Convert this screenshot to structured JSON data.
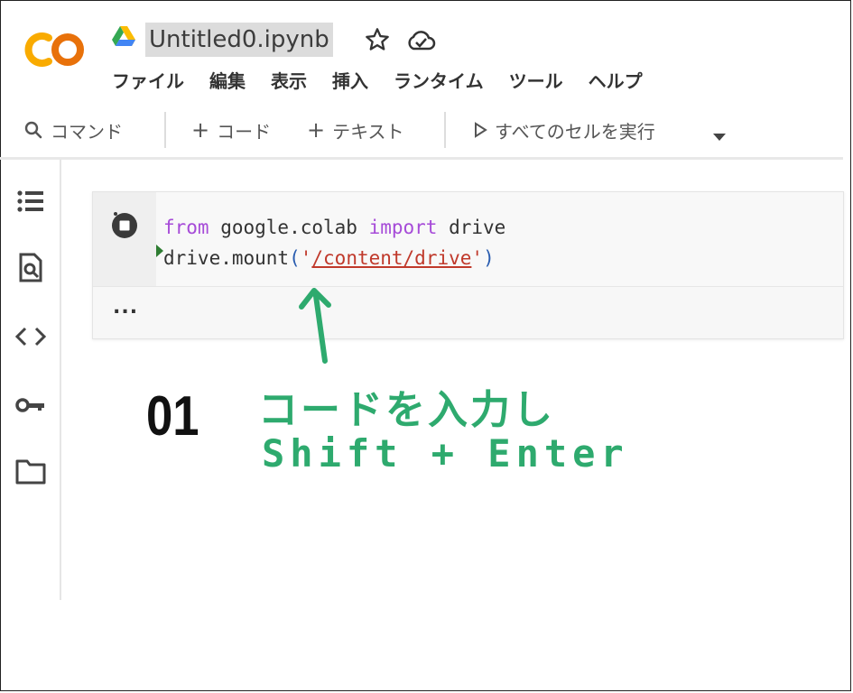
{
  "header": {
    "title": "Untitled0.ipynb",
    "icons": [
      "colab-logo",
      "drive-icon",
      "star-icon",
      "cloud-icon"
    ]
  },
  "menu": [
    "ファイル",
    "編集",
    "表示",
    "挿入",
    "ランタイム",
    "ツール",
    "ヘルプ"
  ],
  "toolbar": {
    "command_label": "コマンド",
    "add_code_label": "コード",
    "add_text_label": "テキスト",
    "run_all_label": "すべてのセルを実行"
  },
  "sidebar": {
    "icons": [
      "toc-icon",
      "find-icon",
      "code-snippets-icon",
      "secrets-key-icon",
      "folder-icon"
    ]
  },
  "cell": {
    "line1": {
      "kw1": "from",
      "mod": " google.colab ",
      "kw2": "import",
      "name": " drive"
    },
    "line2": {
      "call": "drive.mount",
      "open": "(",
      "q1": "'",
      "path": "/content/drive",
      "q2": "'",
      "close": ")"
    },
    "output": "..."
  },
  "annotation": {
    "step": "01",
    "line1": "コードを入力し",
    "line2": "Shift + Enter"
  },
  "colors": {
    "annotation": "#2eaa6e",
    "keyword": "#a64bd8",
    "string": "#c0392b",
    "colab_orange": "#f9ab00",
    "colab_dark": "#e8710a"
  }
}
